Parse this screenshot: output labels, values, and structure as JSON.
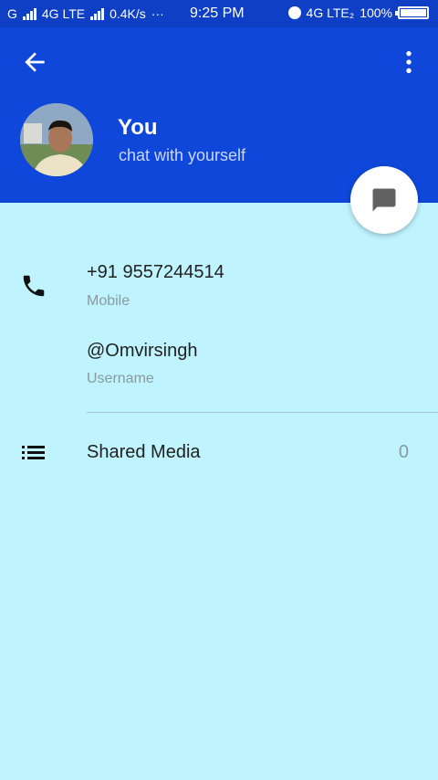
{
  "status_bar": {
    "carrier1": "G",
    "carrier2": "4G LTE",
    "speed": "0.4K/s",
    "dots": "···",
    "time": "9:25 PM",
    "network_right": "4G LTE₂",
    "battery": "100%"
  },
  "header": {
    "name": "You",
    "subtitle": "chat with yourself",
    "back_icon": "arrow-left-icon",
    "menu_icon": "more-vert-icon",
    "colors": {
      "header_bg": "#0e47d9",
      "status_bg": "#0f3fc4"
    }
  },
  "fab": {
    "icon": "chat-bubble-icon"
  },
  "contact": {
    "phone": "+91 9557244514",
    "phone_label": "Mobile",
    "username": "@Omvirsingh",
    "username_label": "Username"
  },
  "shared_media": {
    "label": "Shared Media",
    "count": "0"
  },
  "colors": {
    "background": "#bff3fd"
  }
}
